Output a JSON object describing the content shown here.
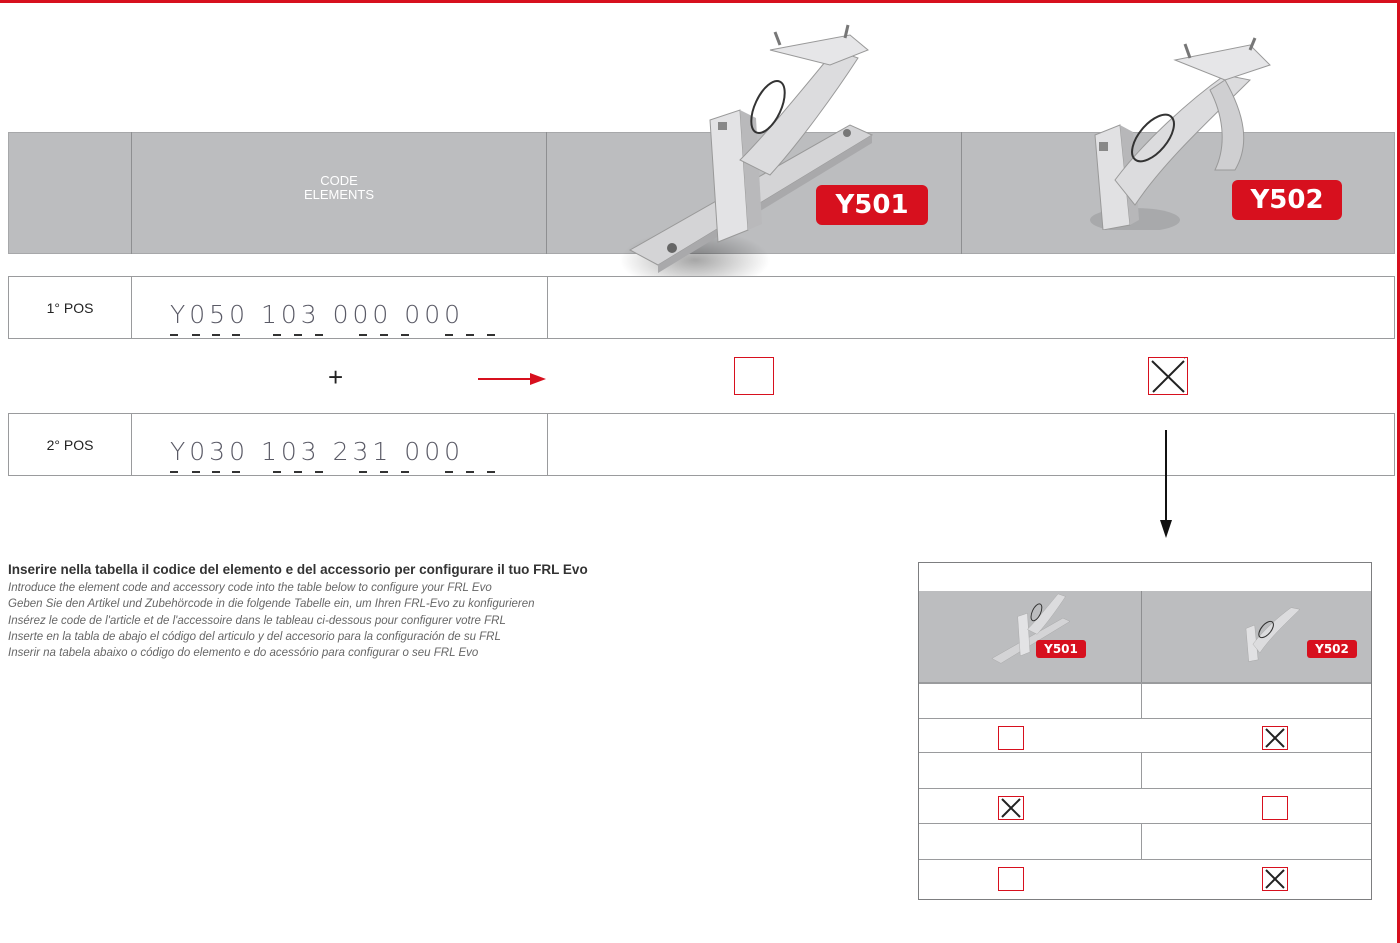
{
  "header": {
    "code_label": "CODE",
    "elements_label": "ELEMENTS"
  },
  "products": [
    {
      "code": "Y501"
    },
    {
      "code": "Y502"
    }
  ],
  "rows": [
    {
      "position": "1° POS",
      "code_groups": [
        "Y050",
        "103",
        "000",
        "000"
      ]
    },
    {
      "position": "2° POS",
      "code_groups": [
        "Y030",
        "103",
        "231",
        "000"
      ]
    }
  ],
  "plus_symbol": "+",
  "selection": {
    "Y501": "unchecked",
    "Y502": "checked"
  },
  "instructions": {
    "title": "Inserire nella tabella il codice del elemento e del accessorio per configurare il tuo FRL Evo",
    "lines": [
      "Introduce the element code and accessory code into the table below to configure your FRL Evo",
      "Geben Sie den Artikel und Zubehörcode in die folgende Tabelle ein, um Ihren FRL-Evo zu konfigurieren",
      "Insérez le code de l'article et de l'accessoire dans le tableau ci-dessous pour configurer votre FRL",
      "Inserte en la tabla de abajo el código del articulo y del accesorio para la configuración de su FRL",
      "Inserir na tabela abaixo o código do elemento e do acessório para configurar o seu FRL Evo"
    ]
  },
  "mini_table": {
    "products": [
      "Y501",
      "Y502"
    ],
    "checkbox_rows": [
      [
        "unchecked",
        "checked"
      ],
      [
        "checked",
        "unchecked"
      ],
      [
        "unchecked",
        "checked"
      ]
    ]
  },
  "colors": {
    "accent": "#d7101e",
    "header_band": "#bcbdbf",
    "border": "#9a9b9d"
  }
}
